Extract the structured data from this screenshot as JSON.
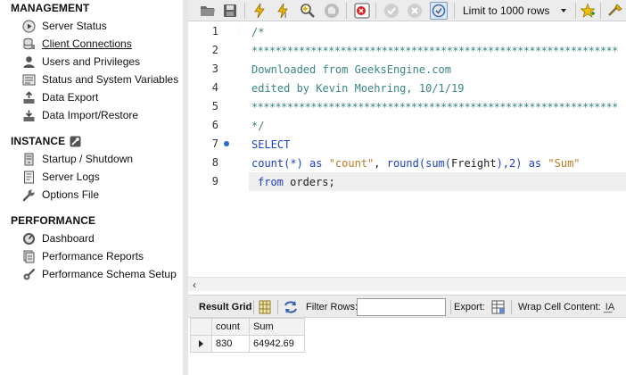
{
  "sidebar": {
    "management": {
      "title": "MANAGEMENT",
      "items": [
        {
          "label": "Server Status",
          "icon": "play-circle-icon"
        },
        {
          "label": "Client Connections",
          "icon": "database-connections-icon"
        },
        {
          "label": "Users and Privileges",
          "icon": "user-icon"
        },
        {
          "label": "Status and System Variables",
          "icon": "variables-icon"
        },
        {
          "label": "Data Export",
          "icon": "export-icon"
        },
        {
          "label": "Data Import/Restore",
          "icon": "import-icon"
        }
      ]
    },
    "instance": {
      "title": "INSTANCE",
      "items": [
        {
          "label": "Startup / Shutdown",
          "icon": "server-icon"
        },
        {
          "label": "Server Logs",
          "icon": "log-icon"
        },
        {
          "label": "Options File",
          "icon": "wrench-icon"
        }
      ]
    },
    "performance": {
      "title": "PERFORMANCE",
      "items": [
        {
          "label": "Dashboard",
          "icon": "dashboard-gauge-icon"
        },
        {
          "label": "Performance Reports",
          "icon": "reports-icon"
        },
        {
          "label": "Performance Schema Setup",
          "icon": "schema-setup-icon"
        }
      ]
    }
  },
  "toolbar": {
    "limit_label": "Limit to 1000 rows",
    "icons": [
      "open-folder-icon",
      "save-icon",
      "execute-icon",
      "execute-current-icon",
      "explain-icon",
      "stop-icon",
      "toggle-error-icon",
      "commit-icon",
      "rollback-icon",
      "autocommit-icon",
      "bookmark-star-icon",
      "beautify-icon"
    ]
  },
  "editor": {
    "line_numbers": [
      "1",
      "2",
      "3",
      "4",
      "5",
      "6",
      "7",
      "8",
      "9"
    ],
    "lines": {
      "l1": "/*",
      "l2": "**************************************************************",
      "l3": "Downloaded from GeeksEngine.com",
      "l4": "edited by Kevin Moehring, 10/1/19",
      "l5": "**************************************************************",
      "l6": "*/",
      "l7": "SELECT",
      "l8": {
        "t1": "count(*)",
        "t2": " as ",
        "t3": "\"count\"",
        "t4": ", ",
        "t5": "round(",
        "t6": "sum(",
        "t7": "Freight",
        "t8": "),2)",
        "t9": " as ",
        "t10": "\"Sum\""
      },
      "l9": {
        "t1": "from",
        "t2": " orders;"
      }
    }
  },
  "result_bar": {
    "tab_label": "Result Grid",
    "filter_label": "Filter Rows:",
    "filter_value": "",
    "export_label": "Export:",
    "wrap_label": "Wrap Cell Content:",
    "wrap_icon_text": "I͟A"
  },
  "grid": {
    "columns": [
      "count",
      "Sum"
    ],
    "rows": [
      [
        "830",
        "64942.69"
      ]
    ]
  },
  "colors": {
    "keyword": "#1f40c8",
    "string": "#c07a20",
    "comment": "#3f7f7f"
  }
}
